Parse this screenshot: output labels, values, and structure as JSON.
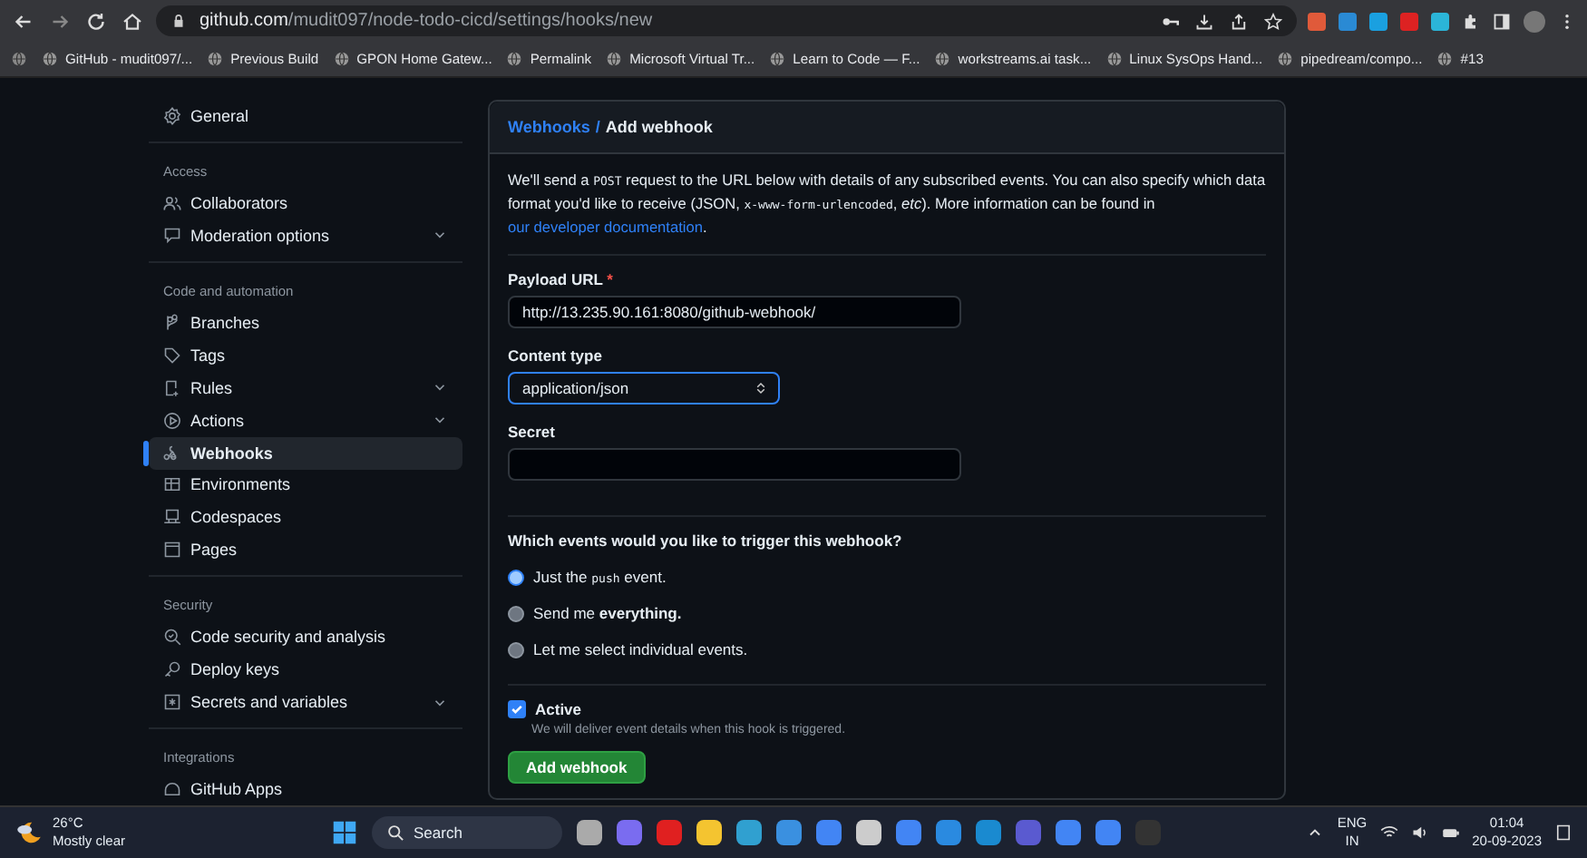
{
  "browser": {
    "url_host": "github.com",
    "url_path": "/mudit097/node-todo-cicd/settings/hooks/new",
    "bookmarks": [
      {
        "label": "GitHub - mudit097/..."
      },
      {
        "label": "Previous Build"
      },
      {
        "label": "GPON Home Gatew..."
      },
      {
        "label": "Permalink"
      },
      {
        "label": "Microsoft Virtual Tr..."
      },
      {
        "label": "Learn to Code — F..."
      },
      {
        "label": "workstreams.ai task..."
      },
      {
        "label": "Linux SysOps Hand..."
      },
      {
        "label": "pipedream/compo..."
      },
      {
        "label": "#13"
      }
    ]
  },
  "sidebar": {
    "sections": [
      {
        "items": [
          {
            "label": "General",
            "selected": false,
            "expandable": false
          }
        ]
      },
      {
        "heading": "Access",
        "items": [
          {
            "label": "Collaborators",
            "selected": false,
            "expandable": false
          },
          {
            "label": "Moderation options",
            "selected": false,
            "expandable": true
          }
        ]
      },
      {
        "heading": "Code and automation",
        "items": [
          {
            "label": "Branches",
            "selected": false,
            "expandable": false
          },
          {
            "label": "Tags",
            "selected": false,
            "expandable": false
          },
          {
            "label": "Rules",
            "selected": false,
            "expandable": true
          },
          {
            "label": "Actions",
            "selected": false,
            "expandable": true
          },
          {
            "label": "Webhooks",
            "selected": true,
            "expandable": false
          },
          {
            "label": "Environments",
            "selected": false,
            "expandable": false
          },
          {
            "label": "Codespaces",
            "selected": false,
            "expandable": false
          },
          {
            "label": "Pages",
            "selected": false,
            "expandable": false
          }
        ]
      },
      {
        "heading": "Security",
        "items": [
          {
            "label": "Code security and analysis",
            "selected": false,
            "expandable": false
          },
          {
            "label": "Deploy keys",
            "selected": false,
            "expandable": false
          },
          {
            "label": "Secrets and variables",
            "selected": false,
            "expandable": true
          }
        ]
      },
      {
        "heading": "Integrations",
        "items": [
          {
            "label": "GitHub Apps",
            "selected": false,
            "expandable": false
          }
        ]
      }
    ]
  },
  "panel": {
    "breadcrumb_parent": "Webhooks",
    "breadcrumb_separator": "/",
    "title": "Add webhook",
    "intro": [
      {
        "kind": "text",
        "text": "We'll send a "
      },
      {
        "kind": "code",
        "text": "POST"
      },
      {
        "kind": "text",
        "text": " request to the URL below with details of any subscribed events. You can also specify which data format you'd like to receive (JSON, "
      },
      {
        "kind": "code",
        "text": "x-www-form-urlencoded"
      },
      {
        "kind": "text",
        "text": ", *etc*). More information can be found in "
      },
      {
        "kind": "link",
        "text": "our developer documentation"
      },
      {
        "kind": "text",
        "text": "."
      }
    ],
    "payload_url": {
      "label": "Payload URL",
      "required_mark": "*",
      "value": "http://13.235.90.161:8080/github-webhook/"
    },
    "content_type": {
      "label": "Content type",
      "value": "application/json"
    },
    "secret": {
      "label": "Secret"
    },
    "events_question": "Which events would you like to trigger this webhook?",
    "events": [
      {
        "selected": true,
        "parts": [
          {
            "kind": "text",
            "text": "Just the "
          },
          {
            "kind": "code",
            "text": "push"
          },
          {
            "kind": "text",
            "text": " event."
          }
        ]
      },
      {
        "selected": false,
        "parts": [
          {
            "kind": "text",
            "text": "Send me **everything.**"
          }
        ]
      },
      {
        "selected": false,
        "parts": [
          {
            "kind": "text",
            "text": "Let me select individual events."
          }
        ]
      }
    ],
    "active": {
      "label": "Active",
      "checked": true,
      "hint": "We will deliver event details when this hook is triggered."
    },
    "submit": "Add webhook"
  },
  "taskbar": {
    "temperature": "26°C",
    "weather": "Mostly clear",
    "search_placeholder": "Search",
    "language": "ENG",
    "region": "IN",
    "time": "01:04",
    "date": "20-09-2023"
  }
}
